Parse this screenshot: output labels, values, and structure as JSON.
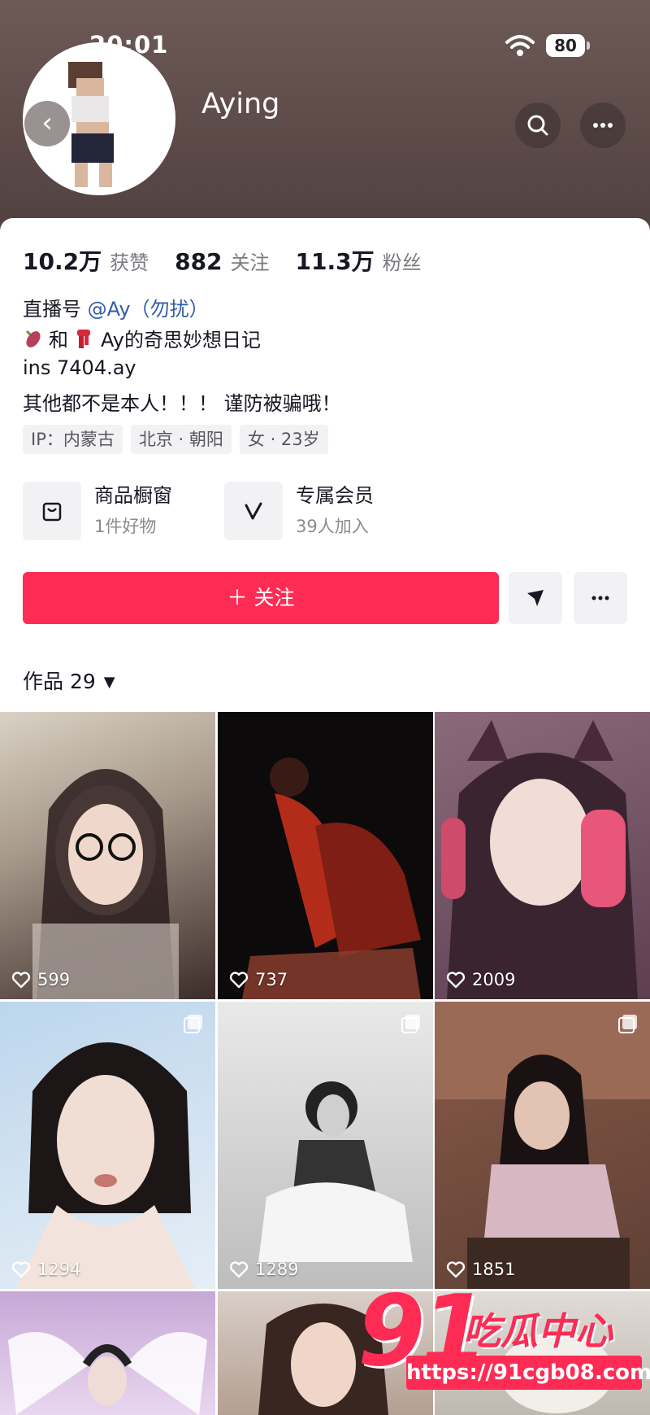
{
  "status_bar": {
    "time": "20:01",
    "battery": "80"
  },
  "header": {
    "username": "Aying"
  },
  "stats": [
    {
      "value": "10.2万",
      "label": "获赞"
    },
    {
      "value": "882",
      "label": "关注"
    },
    {
      "value": "11.3万",
      "label": "粉丝"
    }
  ],
  "bio": {
    "live_label": "直播号",
    "live_handle": "@Ay（勿扰）",
    "line2_text": "和",
    "line2_suffix": "Ay的奇思妙想日记",
    "line3": "ins 7404.ay",
    "line4": "其他都不是本人！！！ 谨防被骗哦！"
  },
  "tags": [
    "IP：内蒙古",
    "北京 · 朝阳",
    "女 · 23岁"
  ],
  "features": [
    {
      "title": "商品橱窗",
      "sub": "1件好物",
      "icon": "shopping-bag-icon"
    },
    {
      "title": "专属会员",
      "sub": "39人加入",
      "icon": "v-member-icon"
    }
  ],
  "actions": {
    "follow_label": "＋ 关注"
  },
  "works": {
    "label": "作品 29"
  },
  "videos": [
    {
      "likes": "599"
    },
    {
      "likes": "737"
    },
    {
      "likes": "2009"
    },
    {
      "likes": "1294"
    },
    {
      "likes": "1289"
    },
    {
      "likes": "1851"
    },
    {
      "likes": ""
    },
    {
      "likes": ""
    },
    {
      "likes": ""
    }
  ],
  "watermark": {
    "number": "91",
    "text": "吃瓜中心",
    "url": "https://91cgb08.com"
  },
  "colors": {
    "accent": "#fe2c55",
    "link": "#2f5da8"
  }
}
